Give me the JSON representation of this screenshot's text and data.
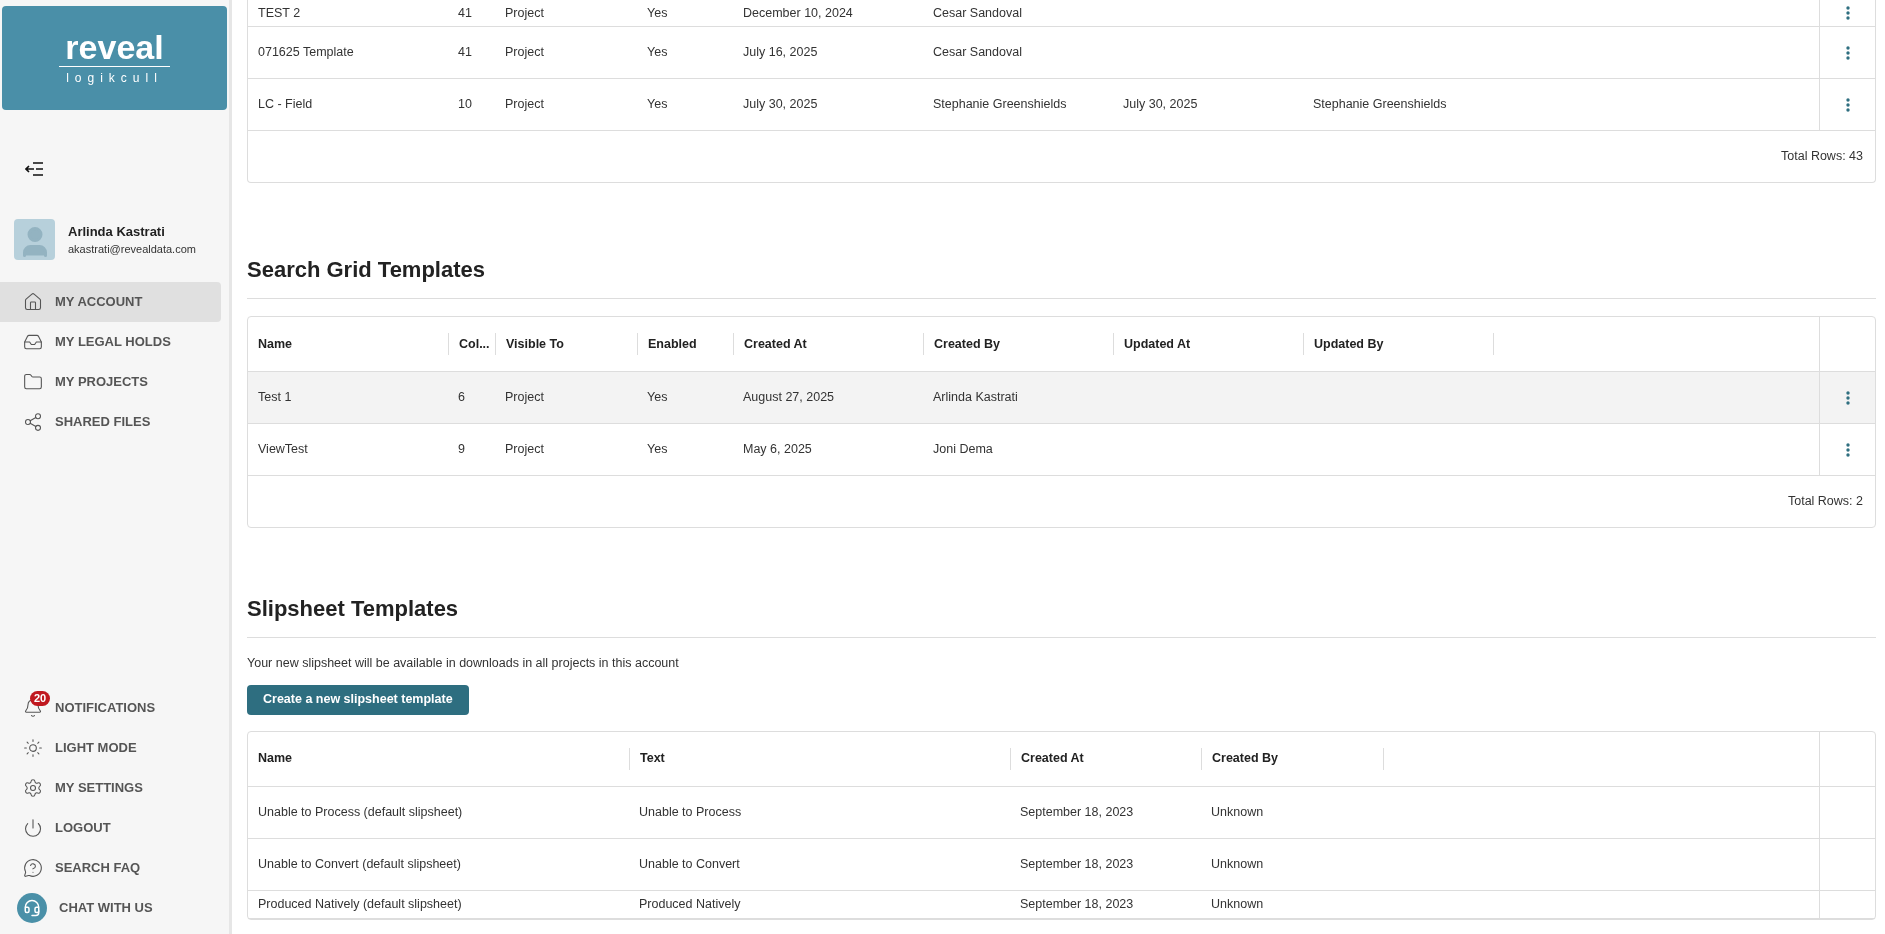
{
  "sidebar": {
    "logo": {
      "wordmark": "reveal",
      "subtitle": "logikcull"
    },
    "user": {
      "name": "Arlinda Kastrati",
      "email": "akastrati@revealdata.com"
    },
    "nav_items": [
      {
        "label": "MY ACCOUNT",
        "kind": "home",
        "selected": true
      },
      {
        "label": "MY LEGAL HOLDS",
        "kind": "hold",
        "selected": false
      },
      {
        "label": "MY PROJECTS",
        "kind": "folder",
        "selected": false
      },
      {
        "label": "SHARED FILES",
        "kind": "share",
        "selected": false
      }
    ],
    "bottom_items": [
      {
        "label": "NOTIFICATIONS",
        "kind": "bell",
        "badge": "20"
      },
      {
        "label": "LIGHT MODE",
        "kind": "sun"
      },
      {
        "label": "MY SETTINGS",
        "kind": "gear"
      },
      {
        "label": "LOGOUT",
        "kind": "power"
      },
      {
        "label": "SEARCH FAQ",
        "kind": "faq"
      },
      {
        "label": "CHAT WITH US",
        "kind": "chat"
      }
    ]
  },
  "top_table": {
    "rows": [
      {
        "cells": [
          "TEST 2",
          "41",
          "Project",
          "Yes",
          "December 10, 2024",
          "Cesar Sandoval",
          "",
          ""
        ]
      },
      {
        "cells": [
          "071625 Template",
          "41",
          "Project",
          "Yes",
          "July 16, 2025",
          "Cesar Sandoval",
          "",
          ""
        ]
      },
      {
        "cells": [
          "LC - Field",
          "10",
          "Project",
          "Yes",
          "July 30, 2025",
          "Stephanie Greenshields",
          "July 30, 2025",
          "Stephanie Greenshields"
        ]
      }
    ],
    "total": "Total Rows: 43"
  },
  "search_grid_templates": {
    "title": "Search Grid Templates",
    "columns": [
      "Name",
      "Col...",
      "Visible To",
      "Enabled",
      "Created At",
      "Created By",
      "Updated At",
      "Updated By"
    ],
    "rows": [
      {
        "cells": [
          "Test 1",
          "6",
          "Project",
          "Yes",
          "August 27, 2025",
          "Arlinda Kastrati",
          "",
          ""
        ],
        "selected": true
      },
      {
        "cells": [
          "ViewTest",
          "9",
          "Project",
          "Yes",
          "May 6, 2025",
          "Joni Dema",
          "",
          ""
        ],
        "selected": false
      }
    ],
    "total": "Total Rows: 2"
  },
  "slipsheet_templates": {
    "title": "Slipsheet Templates",
    "description": "Your new slipsheet will be available in downloads in all projects in this account",
    "create_button": "Create a new slipsheet template",
    "columns": [
      "Name",
      "Text",
      "Created At",
      "Created By"
    ],
    "rows": [
      {
        "cells": [
          "Unable to Process (default slipsheet)",
          "Unable to Process",
          "September 18, 2023",
          "Unknown"
        ]
      },
      {
        "cells": [
          "Unable to Convert (default slipsheet)",
          "Unable to Convert",
          "September 18, 2023",
          "Unknown"
        ]
      },
      {
        "cells": [
          "Produced Natively (default slipsheet)",
          "Produced Natively",
          "September 18, 2023",
          "Unknown"
        ]
      }
    ]
  }
}
